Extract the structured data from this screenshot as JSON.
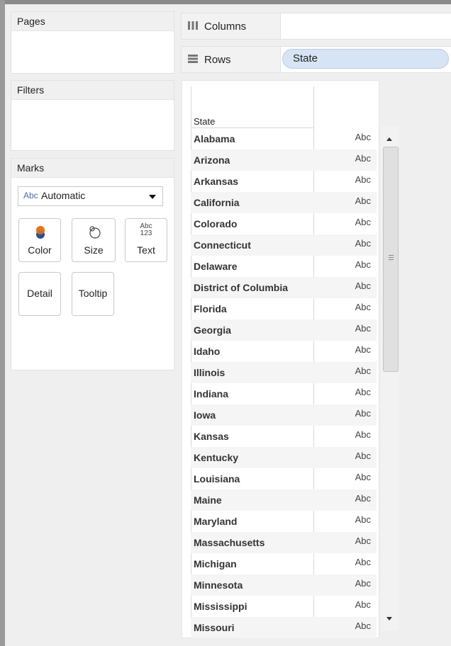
{
  "cards": {
    "pages": {
      "title": "Pages"
    },
    "filters": {
      "title": "Filters"
    },
    "marks": {
      "title": "Marks",
      "type_prefix": "Abc",
      "type_label": "Automatic",
      "buttons": {
        "color": "Color",
        "size": "Size",
        "text": "Text",
        "text_icon_top": "Abc",
        "text_icon_bottom": "123",
        "detail": "Detail",
        "tooltip": "Tooltip"
      }
    }
  },
  "shelves": {
    "columns": {
      "label": "Columns"
    },
    "rows": {
      "label": "Rows",
      "pill": "State"
    }
  },
  "table": {
    "column_header": "State",
    "value_label": "Abc",
    "rows": [
      "Alabama",
      "Arizona",
      "Arkansas",
      "California",
      "Colorado",
      "Connecticut",
      "Delaware",
      "District of Columbia",
      "Florida",
      "Georgia",
      "Idaho",
      "Illinois",
      "Indiana",
      "Iowa",
      "Kansas",
      "Kentucky",
      "Louisiana",
      "Maine",
      "Maryland",
      "Massachusetts",
      "Michigan",
      "Minnesota",
      "Mississippi",
      "Missouri"
    ]
  },
  "colors": {
    "pill_bg": "#d7e4f5",
    "color_icon_top": "#e8731c",
    "color_icon_bottom": "#2a4f8f"
  }
}
